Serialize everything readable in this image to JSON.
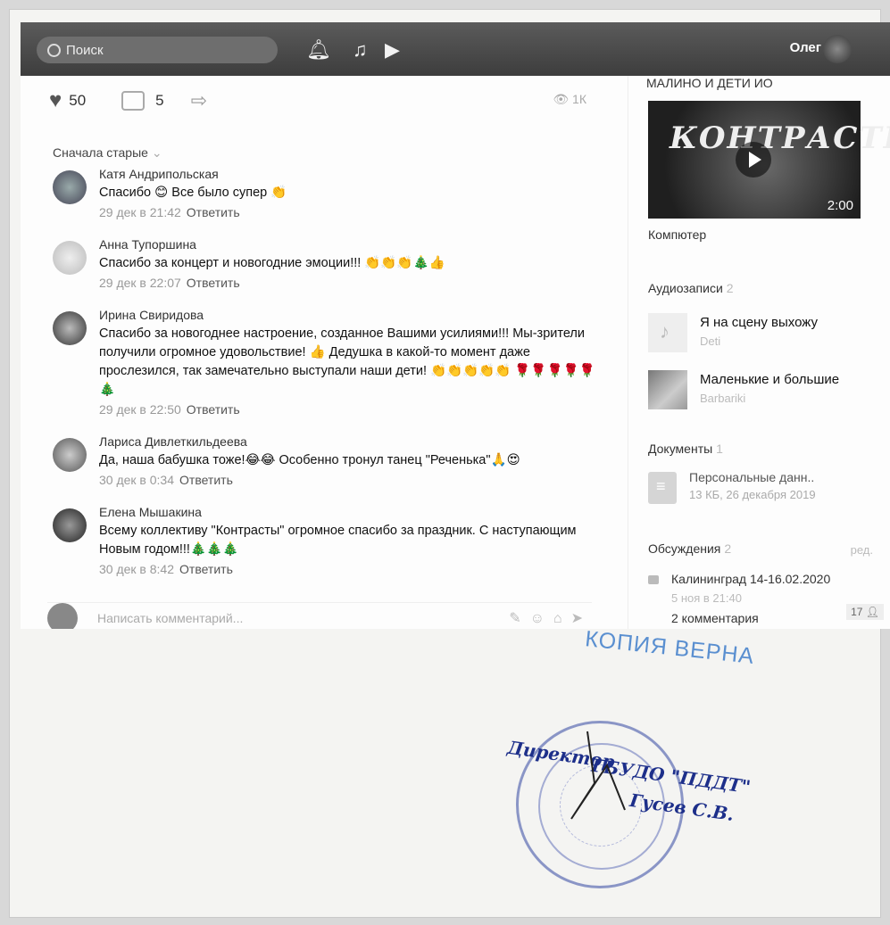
{
  "topbar": {
    "search_placeholder": "Поиск",
    "user_name": "Олег"
  },
  "post": {
    "likes": "50",
    "comments": "5",
    "views": "1К"
  },
  "sort_label": "Сначала старые",
  "comments": [
    {
      "name": "Катя Андрипольская",
      "text": "Спасибо 😊 Все было супер 👏",
      "date": "29 дек в 21:42",
      "reply": "Ответить"
    },
    {
      "name": "Анна Тупоршина",
      "text": "Спасибо за концерт и новогодние эмоции!!! 👏👏👏🎄👍",
      "date": "29 дек в 22:07",
      "reply": "Ответить"
    },
    {
      "name": "Ирина Свиридова",
      "text": "Спасибо за новогоднее настроение, созданное Вашими усилиями!!! Мы-зрители получили огромное удовольствие! 👍 Дедушка в какой-то момент даже прослезился, так замечательно выступали наши дети! 👏👏👏👏👏 🌹🌹🌹🌹🌹🎄",
      "date": "29 дек в 22:50",
      "reply": "Ответить"
    },
    {
      "name": "Лариса Дивлеткильдеева",
      "text": "Да, наша бабушка тоже!😂😂 Особенно тронул танец \"Реченька\"🙏😍",
      "date": "30 дек в 0:34",
      "reply": "Ответить"
    },
    {
      "name": "Елена Мышакина",
      "text": "Всему коллективу \"Контрасты\" огромное спасибо за праздник. С наступающим Новым годом!!!🎄🎄🎄",
      "date": "30 дек в 8:42",
      "reply": "Ответить"
    }
  ],
  "comment_input_placeholder": "Написать комментарий...",
  "sidebar": {
    "video_section_title": "МАЛИНО И ДЕТИ ИО",
    "video_overlay_title": "КОНТРАСТЫ",
    "video_duration": "2:00",
    "video_label": "Компютер",
    "audio_title": "Аудиозаписи",
    "audio_count": "2",
    "tracks": [
      {
        "title": "Я на сцену выхожу",
        "artist": "Deti"
      },
      {
        "title": "Маленькие и большие",
        "artist": "Barbariki"
      }
    ],
    "docs_title": "Документы",
    "docs_count": "1",
    "doc": {
      "title": "Персональные данн..",
      "meta": "13 КБ, 26 декабря 2019"
    },
    "discussions_title": "Обсуждения",
    "discussions_count": "2",
    "discussions_edit": "ред.",
    "topic": {
      "title": "Калининград 14-16.02.2020",
      "date": "5 ноя в 21:40",
      "comments": "2 комментария"
    },
    "online_count": "17"
  },
  "stamp": {
    "copy_text": "КОПИЯ ВЕРНА",
    "line1": "Директор",
    "line2": "ГБУДО \"ПДДТ\"",
    "line3": "Гусев С.В."
  }
}
